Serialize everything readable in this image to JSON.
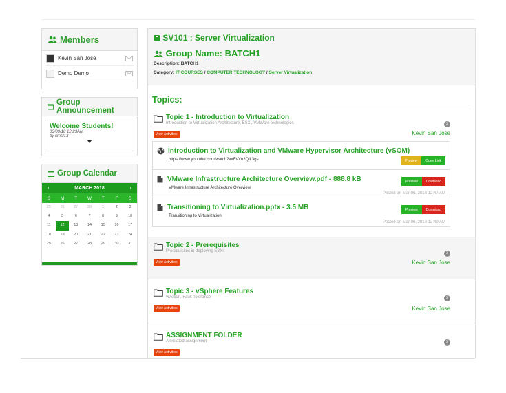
{
  "members": {
    "title": "Members",
    "items": [
      {
        "name": "Kevin San Jose"
      },
      {
        "name": "Demo Demo"
      }
    ]
  },
  "announcement": {
    "title": "Group Announcement",
    "item_title": "Welcome Students!",
    "date": "03/09/18 12:23AM",
    "by": "by kms/13"
  },
  "calendar": {
    "title": "Group Calendar",
    "prev": "‹",
    "next": "›",
    "month": "MARCH 2018",
    "dow": [
      "S",
      "M",
      "T",
      "W",
      "T",
      "F",
      "S"
    ],
    "days": [
      "25",
      "26",
      "27",
      "28",
      "1",
      "2",
      "3",
      "4",
      "5",
      "6",
      "7",
      "8",
      "9",
      "10",
      "11",
      "12",
      "13",
      "14",
      "15",
      "16",
      "17",
      "18",
      "19",
      "20",
      "21",
      "22",
      "23",
      "24",
      "25",
      "26",
      "27",
      "28",
      "29",
      "30",
      "31"
    ],
    "muted_count": 4,
    "today": "12"
  },
  "course": {
    "title": "SV101 : Server Virtualization",
    "group_name": "Group Name: BATCH1",
    "description": "Description: BATCH1",
    "category_label": "Category: ",
    "category_1": "IT COURSES",
    "category_2": "COMPUTER TECHNOLOGY",
    "category_3": "Server Virtualization",
    "sep": " / "
  },
  "topics_title": "Topics:",
  "topics": [
    {
      "title": "Topic 1 - Introduction to Virtualization",
      "subtitle": "Introduction to Virtualization Architecture, ESXi, VMWare technologies",
      "badge": "3",
      "button": "View Activities",
      "author": "Kevin San Jose",
      "files": [
        {
          "title": "Introduction to Virtualization and VMware Hypervisor Architecture (vSOM)",
          "subtitle": "https://www.youtube.com/watch?v=EvXn2QiL3gs",
          "btn1": "Preview",
          "btn2": "Open Link",
          "posted": "",
          "icon": "globe-icon"
        },
        {
          "title": "VMware Infrastructure Architecture Overview.pdf - 888.8 kB",
          "subtitle": "VMware Infrastructure Architecture Overview",
          "btn1": "Preview",
          "btn2": "Download",
          "posted": "Posted on Mar 06, 2018 12:47 AM",
          "icon": "file-icon"
        },
        {
          "title": "Transitioning to Virtualization.pptx - 3.5 MB",
          "subtitle": "Transitioning to Virtualization",
          "btn1": "Preview",
          "btn2": "Download",
          "posted": "Posted on Mar 06, 2018 12:49 AM",
          "icon": "file-icon"
        }
      ]
    },
    {
      "title": "Topic 2 - Prerequisites",
      "subtitle": "Prerequisites in deploying ESXi",
      "badge": "3",
      "button": "View Activities",
      "author": "Kevin San Jose"
    },
    {
      "title": "Topic 3 - vSphere Features",
      "subtitle": "vMotion, Fault Tolerance",
      "badge": "3",
      "button": "View Activities",
      "author": "Kevin San Jose"
    },
    {
      "title": "ASSIGNMENT FOLDER",
      "subtitle": "All related assignment",
      "badge": "3",
      "button": "View Activities",
      "author": ""
    }
  ],
  "colors": {
    "accent": "#27a227",
    "danger": "#d9261c",
    "warning": "#e0b21b"
  }
}
